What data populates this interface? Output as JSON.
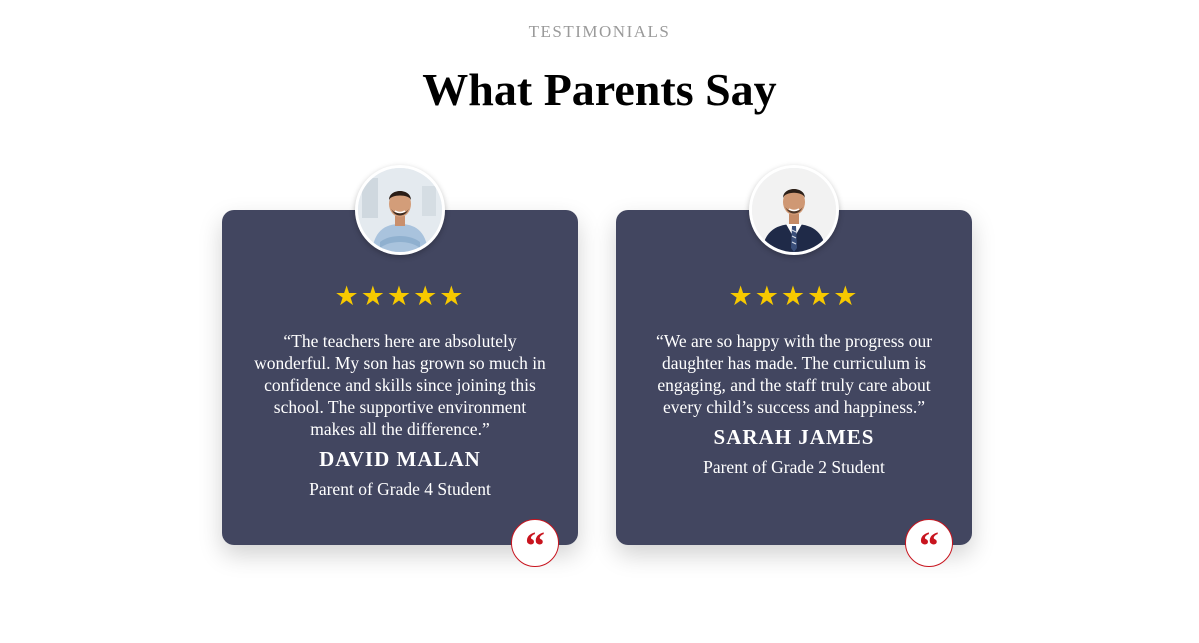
{
  "header": {
    "label": "TESTIMONIALS",
    "title": "What Parents Say"
  },
  "testimonials": [
    {
      "stars": "★★★★★",
      "rating": 5,
      "quote": "“The teachers here are absolutely wonderful. My son has grown so much in confidence and skills since joining this school. The supportive environment makes all the difference.”",
      "name": "DAVID MALAN",
      "role": "Parent of Grade 4 Student",
      "avatar_icon": "person-photo-icon"
    },
    {
      "stars": "★★★★★",
      "rating": 5,
      "quote": "“We are so happy with the progress our daughter has made. The curriculum is engaging, and the staff truly care about every child’s success and happiness.”",
      "name": "SARAH JAMES",
      "role": "Parent of Grade 2 Student",
      "avatar_icon": "person-photo-icon"
    }
  ],
  "quote_badge": {
    "glyph": "“",
    "icon": "quote-icon"
  },
  "colors": {
    "card_background": "#424660",
    "star": "#f7c900",
    "quote_accent": "#c8141e",
    "label": "#9a9a9a"
  }
}
